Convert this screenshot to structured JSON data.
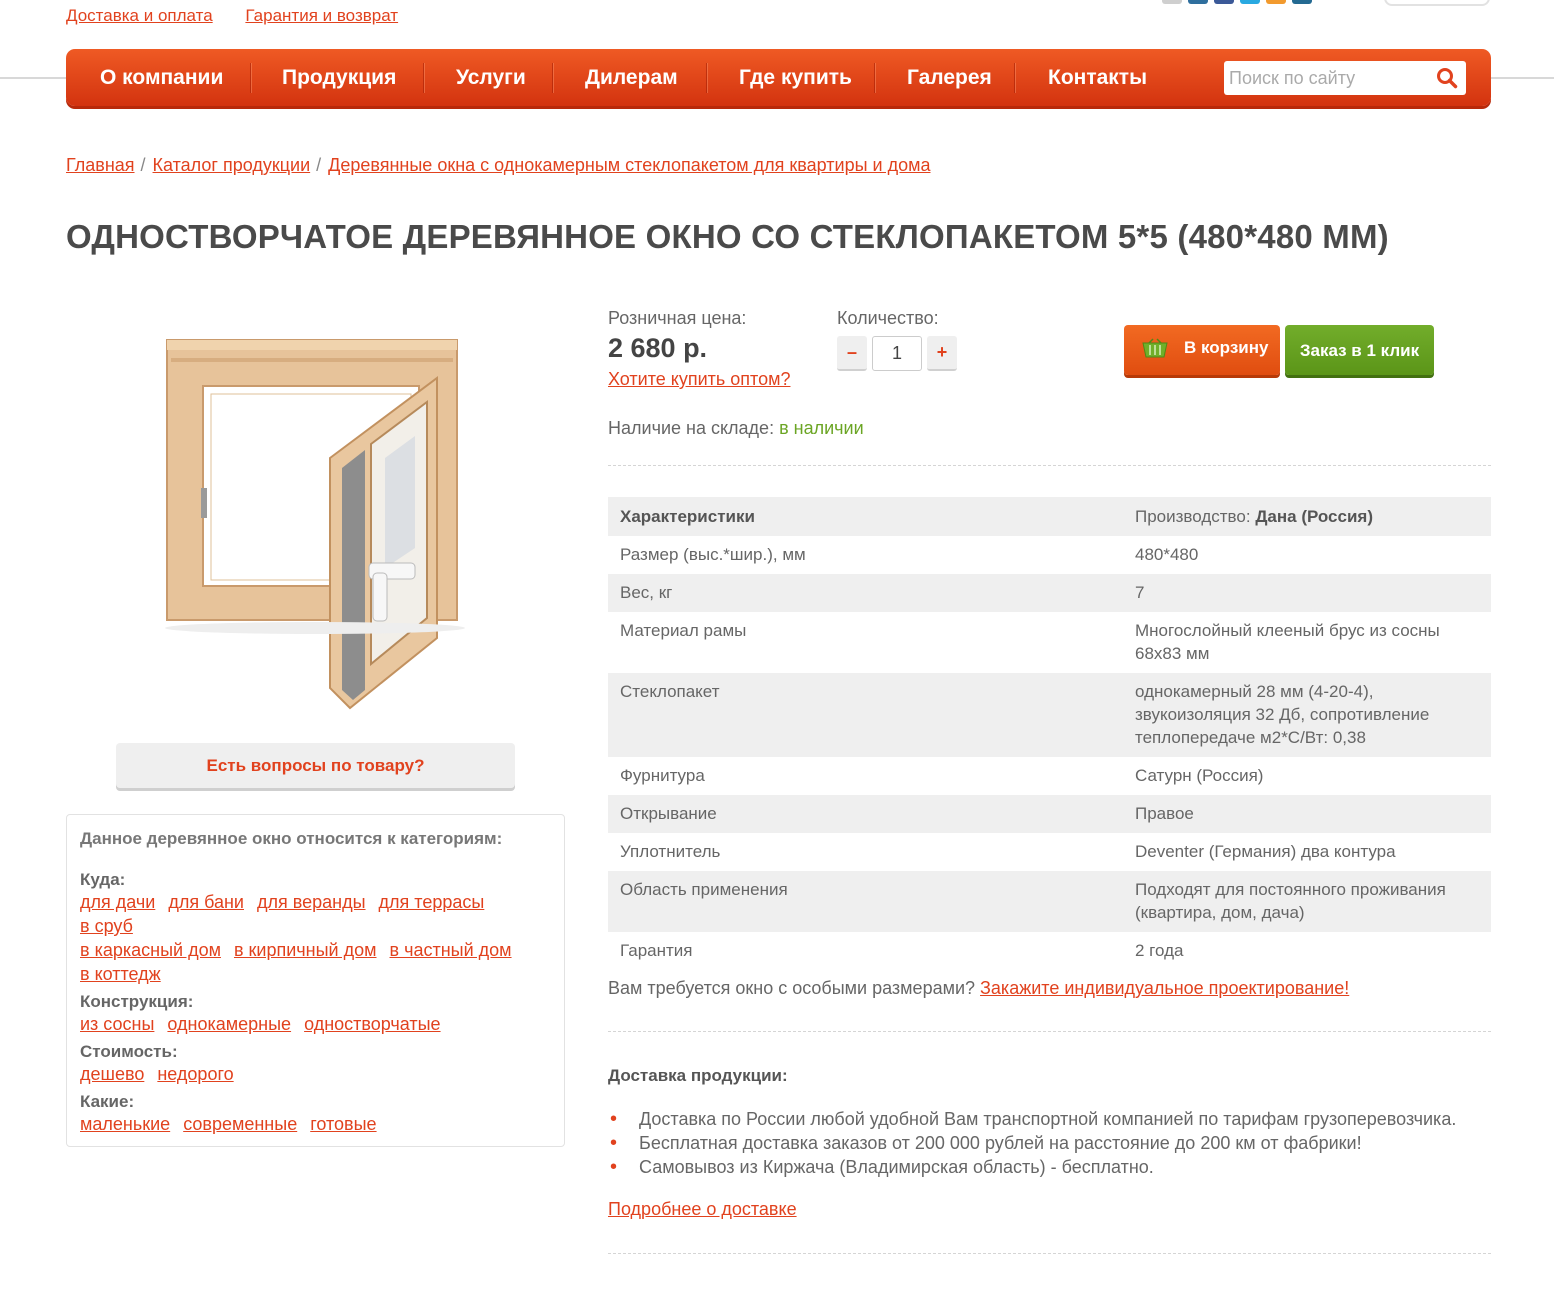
{
  "top_links": [
    "Доставка и оплата",
    "Гарантия и возврат"
  ],
  "nav": [
    "О компании",
    "Продукция",
    "Услуги",
    "Дилерам",
    "Где купить",
    "Галерея",
    "Контакты"
  ],
  "search": {
    "placeholder": "Поиск по сайту",
    "icon": "search-icon"
  },
  "breadcrumb": {
    "items": [
      "Главная",
      "Каталог продукции",
      "Деревянные окна с однокамерным стеклопакетом для квартиры и дома"
    ],
    "separator": "/"
  },
  "title": "ОДНОСТВОРЧАТОЕ ДЕРЕВЯННОЕ ОКНО СО СТЕКЛОПАКЕТОМ 5*5 (480*480 ММ)",
  "product": {
    "image_icon": "wooden-window-photo",
    "questions_button": "Есть вопросы по товару?",
    "price_label": "Розничная цена:",
    "price": "2 680 р.",
    "wholesale_link": "Хотите купить оптом?",
    "quantity_label": "Количество:",
    "quantity_minus": "–",
    "quantity_plus": "+",
    "quantity": "1",
    "cart_button": "В корзину",
    "cart_icon": "basket-icon",
    "oneclick_button": "Заказ в 1 клик",
    "stock_label": "Наличие на складе:",
    "stock_value": "в наличии"
  },
  "categories": {
    "title": "Данное деревянное окно относится к категориям:",
    "groups": [
      {
        "label": "Куда:",
        "links": [
          "для дачи",
          "для бани",
          "для веранды",
          "для террасы",
          "в сруб",
          "в каркасный дом",
          "в кирпичный дом",
          "в частный дом",
          "в коттедж"
        ]
      },
      {
        "label": "Конструкция:",
        "links": [
          "из сосны",
          "однокамерные",
          "одностворчатые"
        ]
      },
      {
        "label": "Стоимость:",
        "links": [
          "дешево",
          "недорого"
        ]
      },
      {
        "label": "Какие:",
        "links": [
          "маленькие",
          "современные",
          "готовые"
        ]
      }
    ]
  },
  "specs": {
    "header": "Характеристики",
    "maker_label": "Производство:",
    "maker_value": "Дана (Россия)",
    "rows": [
      [
        "Размер (выс.*шир.), мм",
        "480*480"
      ],
      [
        "Вес, кг",
        "7"
      ],
      [
        "Материал рамы",
        "Многослойный клееный брус из сосны 68х83 мм"
      ],
      [
        "Стеклопакет",
        "однокамерный 28 мм (4-20-4), звукоизоляция 32 Дб, сопротивление теплопередаче м2*С/Вт: 0,38"
      ],
      [
        "Фурнитура",
        "Сатурн (Россия)"
      ],
      [
        "Открывание",
        "Правое"
      ],
      [
        "Уплотнитель",
        "Deventer (Германия) два контура"
      ],
      [
        "Область применения",
        "Подходят для постоянного проживания (квартира, дом, дача)"
      ],
      [
        "Гарантия",
        "2 года"
      ]
    ]
  },
  "special_sizes": {
    "text": "Вам требуется окно с особыми размерами?",
    "link": "Закажите индивидуальное проектирование!"
  },
  "delivery": {
    "title": "Доставка продукции:",
    "items": [
      "Доставка по России любой удобной Вам транспортной компанией по тарифам грузоперевозчика.",
      "Бесплатная доставка заказов от 200 000 рублей на расстояние до 200 км от фабрики!",
      "Самовывоз из Киржача (Владимирская область) - бесплатно."
    ],
    "more_link": "Подробнее о доставке"
  },
  "colors": {
    "accent": "#e1421e",
    "nav": "#e4461a",
    "green": "#6ba524",
    "text": "#555555"
  }
}
